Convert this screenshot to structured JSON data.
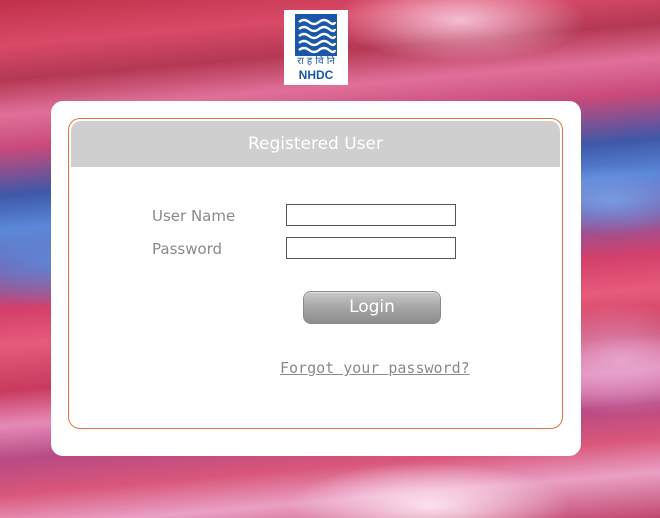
{
  "logo": {
    "hindi_text": "रा ह वि नि",
    "abbreviation": "NHDC",
    "brand_color": "#1a57a8"
  },
  "login_panel": {
    "title": "Registered User",
    "username_label": "User Name",
    "username_value": "",
    "password_label": "Password",
    "password_value": "",
    "login_button": "Login",
    "forgot_link": "Forgot your password?",
    "border_color": "#e0743c"
  }
}
